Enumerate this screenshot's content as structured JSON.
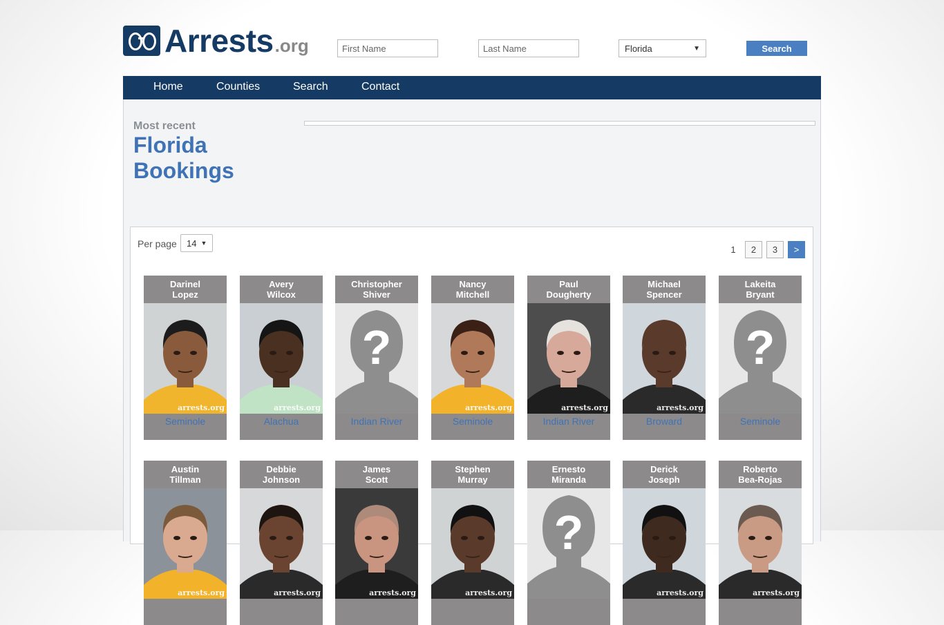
{
  "logo": {
    "text": "Arrests",
    "suffix": ".org"
  },
  "header": {
    "first_name_placeholder": "First Name",
    "last_name_placeholder": "Last Name",
    "state_value": "Florida",
    "search_label": "Search"
  },
  "nav": {
    "items": [
      {
        "label": "Home"
      },
      {
        "label": "Counties"
      },
      {
        "label": "Search"
      },
      {
        "label": "Contact"
      }
    ]
  },
  "page": {
    "kicker": "Most recent",
    "title": "Florida Bookings"
  },
  "listing": {
    "per_page_label": "Per page",
    "per_page_value": "14",
    "pagination": {
      "current": "1",
      "pages": [
        "2",
        "3"
      ],
      "next": ">"
    }
  },
  "bookings": [
    {
      "first": "Darinel",
      "last": "Lopez",
      "county": "Seminole",
      "photo": "mugshot",
      "bg": "#cfd3d4",
      "skin": "#8a5a3c",
      "hair": "#1c1c1c",
      "shirt": "#f0b52c"
    },
    {
      "first": "Avery",
      "last": "Wilcox",
      "county": "Alachua",
      "photo": "mugshot",
      "bg": "#c9cfd2",
      "skin": "#4a3020",
      "hair": "#151515",
      "shirt": "#bfe3c4"
    },
    {
      "first": "Christopher",
      "last": "Shiver",
      "county": "Indian River",
      "photo": "placeholder"
    },
    {
      "first": "Nancy",
      "last": "Mitchell",
      "county": "Seminole",
      "photo": "mugshot",
      "bg": "#d6d8da",
      "skin": "#b07a5a",
      "hair": "#3b2016",
      "shirt": "#f2b22a"
    },
    {
      "first": "Paul",
      "last": "Dougherty",
      "county": "Indian River",
      "photo": "mugshot",
      "bg": "#4d4d4d",
      "skin": "#d6a99a",
      "hair": "#e6e3de",
      "shirt": "#1e1e1e"
    },
    {
      "first": "Michael",
      "last": "Spencer",
      "county": "Broward",
      "photo": "mugshot",
      "bg": "#cfd6dc",
      "skin": "#5a3a2a",
      "hair": "#5a3a2a",
      "shirt": "#2a2a2a"
    },
    {
      "first": "Lakeita",
      "last": "Bryant",
      "county": "Seminole",
      "photo": "placeholder"
    },
    {
      "first": "Austin",
      "last": "Tillman",
      "county": "",
      "photo": "mugshot",
      "bg": "#8c9299",
      "skin": "#d9a990",
      "hair": "#7a5a3a",
      "shirt": "#f2b22a"
    },
    {
      "first": "Debbie",
      "last": "Johnson",
      "county": "",
      "photo": "mugshot",
      "bg": "#d6d8da",
      "skin": "#6a4430",
      "hair": "#1e1410",
      "shirt": "#2a2a2a"
    },
    {
      "first": "James",
      "last": "Scott",
      "county": "",
      "photo": "mugshot",
      "bg": "#3a3a3a",
      "skin": "#c99480",
      "hair": "#ad8a7a",
      "shirt": "#1e1e1e"
    },
    {
      "first": "Stephen",
      "last": "Murray",
      "county": "",
      "photo": "mugshot",
      "bg": "#cfd3d4",
      "skin": "#5a3a2a",
      "hair": "#111",
      "shirt": "#2a2a2a"
    },
    {
      "first": "Ernesto",
      "last": "Miranda",
      "county": "",
      "photo": "placeholder"
    },
    {
      "first": "Derick",
      "last": "Joseph",
      "county": "",
      "photo": "mugshot",
      "bg": "#cfd6dc",
      "skin": "#3e2a1e",
      "hair": "#111",
      "shirt": "#2a2a2a"
    },
    {
      "first": "Roberto",
      "last": "Bea-Rojas",
      "county": "",
      "photo": "mugshot",
      "bg": "#d9dcde",
      "skin": "#c99a84",
      "hair": "#6a5a50",
      "shirt": "#2a2a2a"
    }
  ],
  "watermark": "arrests.org",
  "colors": {
    "navy": "#153a63",
    "accent": "#4a7fc1",
    "link": "#3f73b5",
    "card": "#8d8a8c"
  }
}
